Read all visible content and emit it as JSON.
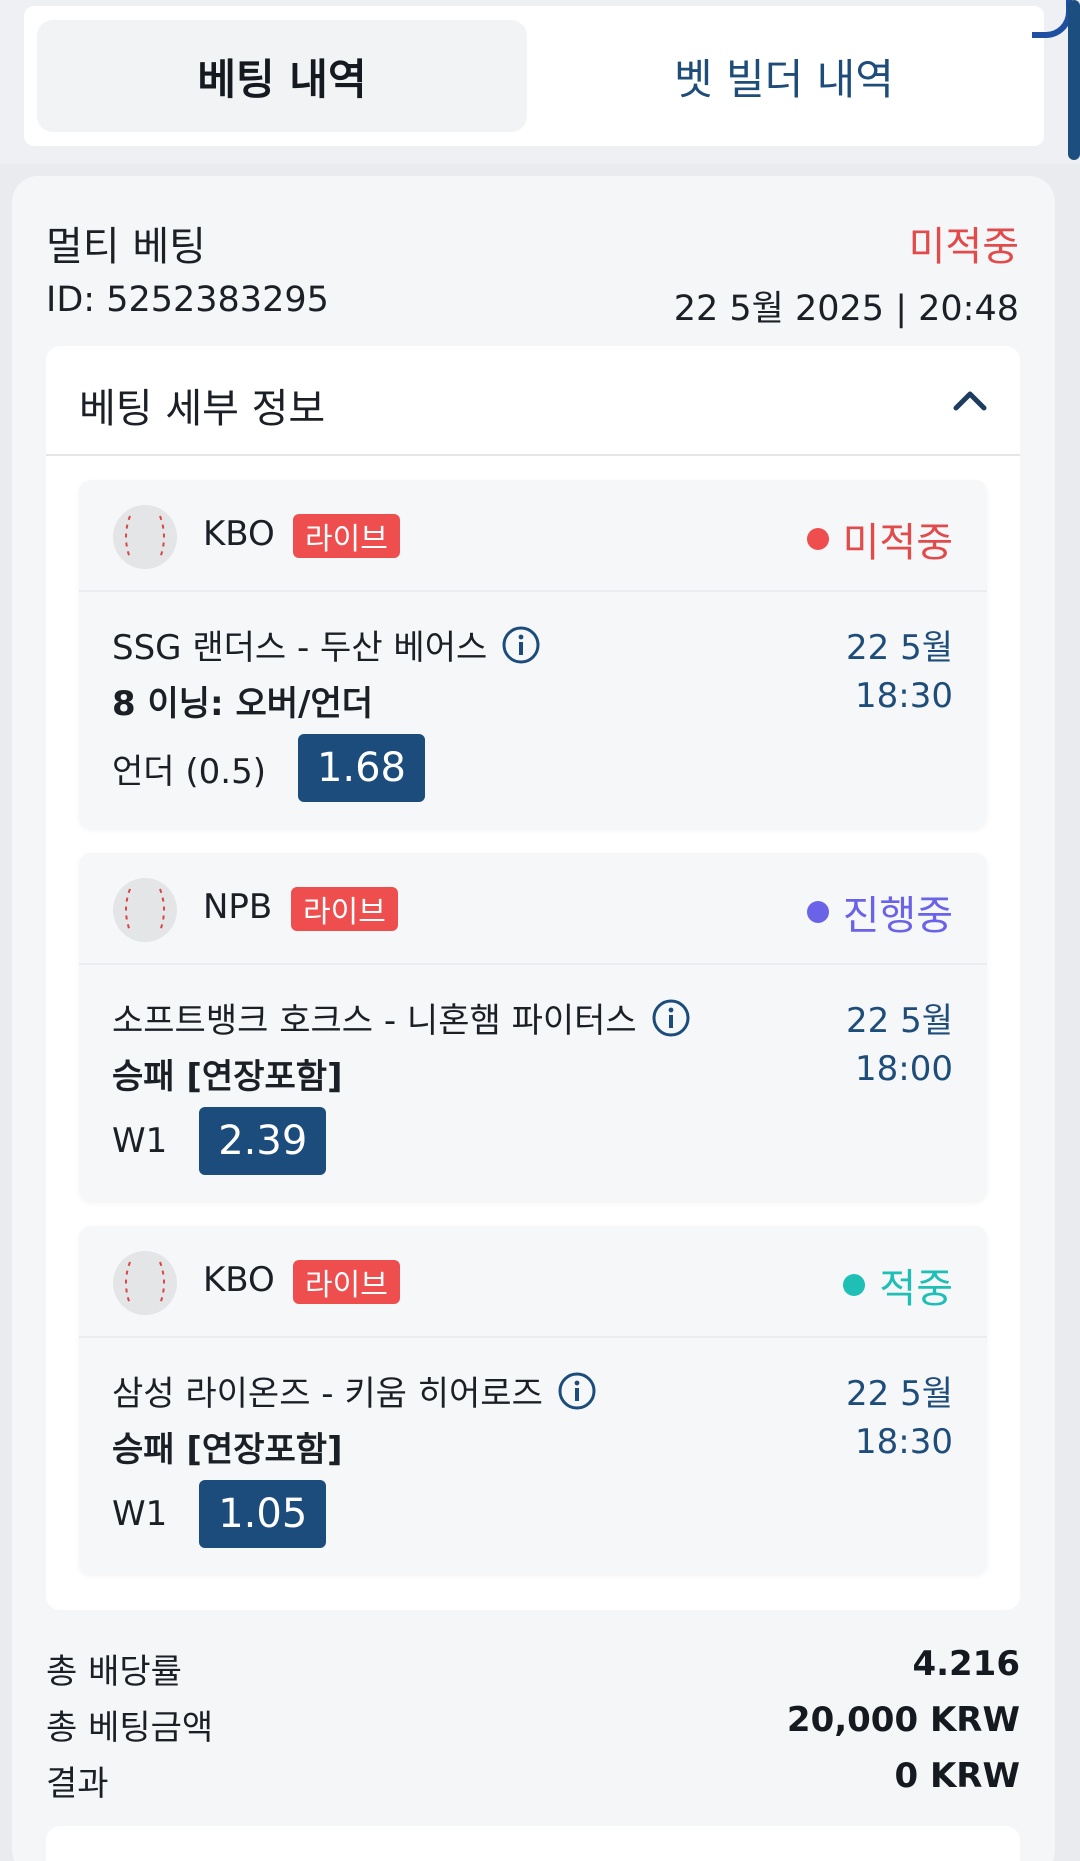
{
  "tabs": {
    "active": "베팅 내역",
    "inactive": "벳 빌더 내역"
  },
  "ticket": {
    "type": "멀티 베팅",
    "status": "미적중",
    "id": "ID: 5252383295",
    "datetime": "22 5월 2025 | 20:48",
    "details_title": "베팅 세부 정보",
    "events": [
      {
        "league": "KBO",
        "live": "라이브",
        "status": "미적중",
        "status_color": "#e14b4b",
        "match": "SSG 랜더스 - 두산 베어스",
        "market": "8 이닝: 오버/언더",
        "date": "22 5월",
        "time": "18:30",
        "pick": "언더 (0.5)",
        "odds": "1.68"
      },
      {
        "league": "NPB",
        "live": "라이브",
        "status": "진행중",
        "status_color": "#6a63e8",
        "match": "소프트뱅크 호크스 - 니혼햄 파이터스",
        "market": "승패 [연장포함]",
        "date": "22 5월",
        "time": "18:00",
        "pick": "W1",
        "odds": "2.39"
      },
      {
        "league": "KBO",
        "live": "라이브",
        "status": "적중",
        "status_color": "#1fbfb5",
        "match": "삼성 라이온즈 - 키움 히어로즈",
        "market": "승패 [연장포함]",
        "date": "22 5월",
        "time": "18:30",
        "pick": "W1",
        "odds": "1.05"
      }
    ],
    "summary": {
      "total_odds_label": "총 배당률",
      "total_odds": "4.216",
      "total_stake_label": "총 베팅금액",
      "total_stake": "20,000 KRW",
      "result_label": "결과",
      "result": "0 KRW"
    }
  },
  "icons": {
    "sport": "baseball-icon",
    "info": "info-icon",
    "collapse": "chevron-up-icon"
  }
}
